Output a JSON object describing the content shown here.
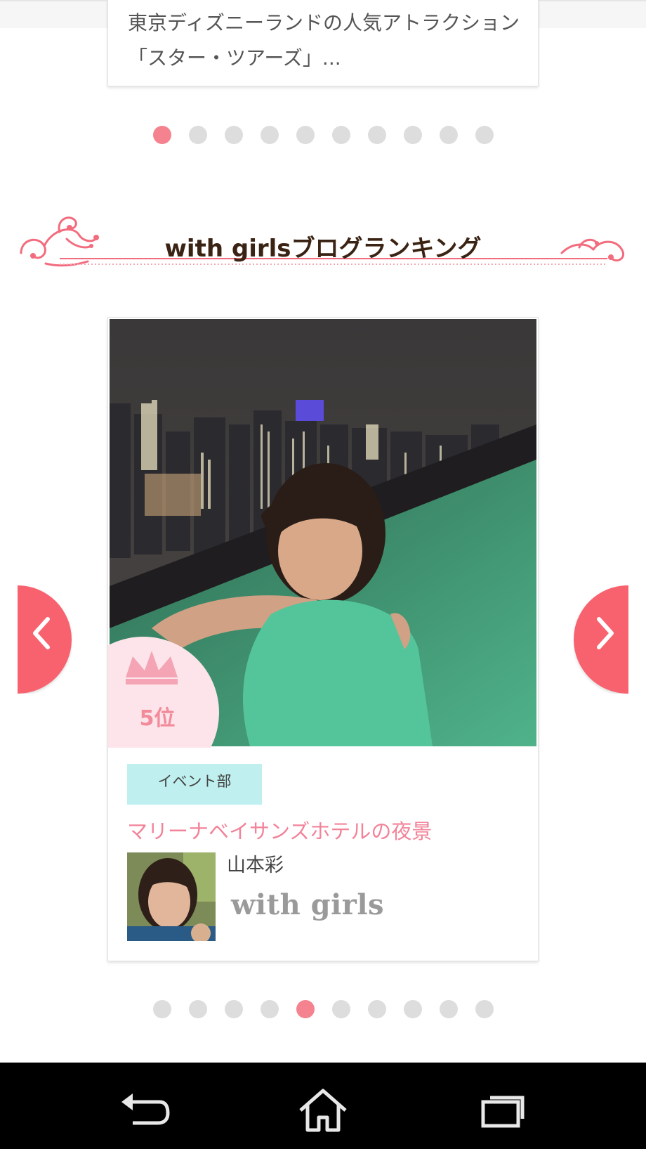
{
  "previous_card": {
    "excerpt": "東京ディズニーランドの人気アトラクション「スター・ツアーズ」..."
  },
  "top_pager": {
    "count": 10,
    "active_index": 0
  },
  "section": {
    "title": "with girlsブログランキング"
  },
  "ranking_card": {
    "rank_label": "5位",
    "category": "イベント部",
    "title": "マリーナベイサンズホテルの夜景",
    "author": "山本彩",
    "brand": "with girls",
    "photo_icon": "night-pool-photo",
    "avatar_icon": "author-avatar-photo"
  },
  "bottom_pager": {
    "count": 10,
    "active_index": 4
  },
  "navigation": {
    "prev_icon": "chevron-left-icon",
    "next_icon": "chevron-right-icon"
  },
  "system_nav": {
    "back_icon": "back-icon",
    "home_icon": "home-icon",
    "recents_icon": "recents-icon"
  },
  "colors": {
    "accent_pink": "#f5838f",
    "arrow_red": "#f8626e",
    "tag_cyan": "#bff0ef",
    "title_brown": "#3b2314"
  }
}
